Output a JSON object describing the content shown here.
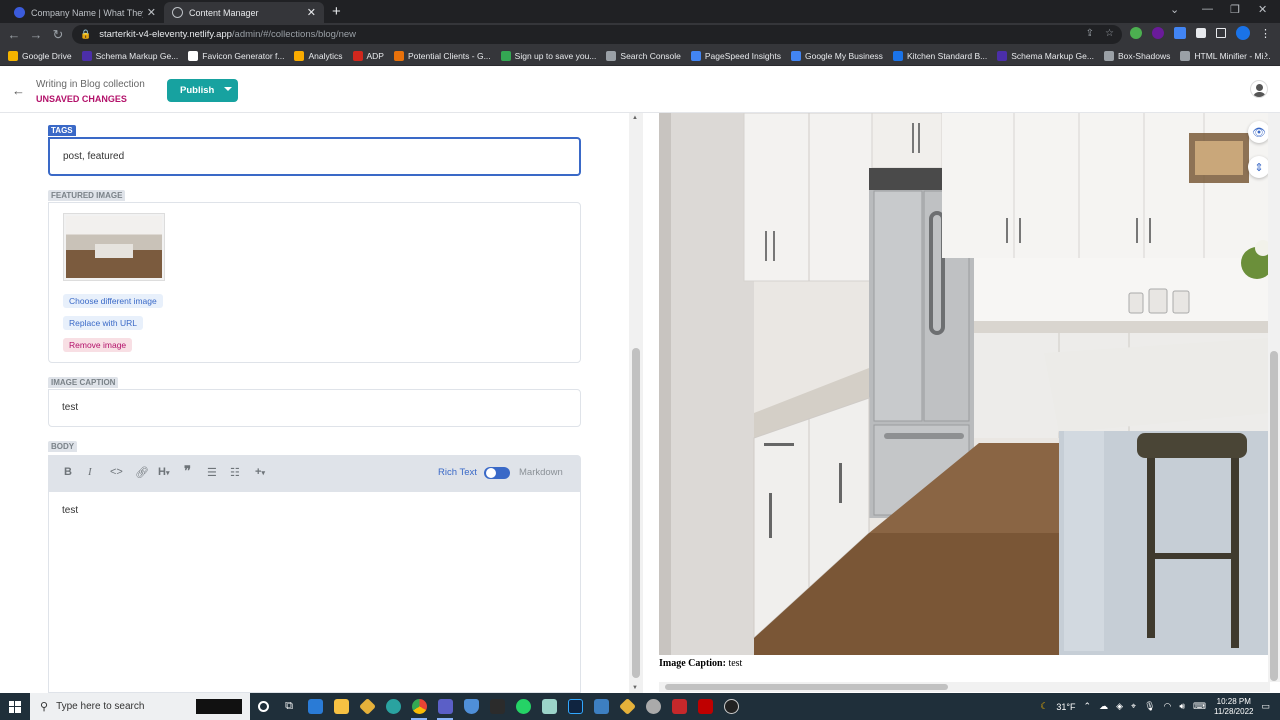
{
  "browser": {
    "tabs": [
      {
        "title": "Company Name | What They Do",
        "icon": "company-favicon",
        "active": false
      },
      {
        "title": "Content Manager",
        "icon": "netlify-cms-favicon",
        "active": true
      }
    ],
    "url_host": "starterkit-v4-eleventy.netlify.app",
    "url_path": "/admin/#/collections/blog/new",
    "bookmarks": [
      {
        "label": "Google Drive",
        "color": "#f4b400"
      },
      {
        "label": "Schema Markup Ge...",
        "color": "#4b2ea8"
      },
      {
        "label": "Favicon Generator f...",
        "color": "#ffffff"
      },
      {
        "label": "Analytics",
        "color": "#f9ab00"
      },
      {
        "label": "ADP",
        "color": "#d0271d"
      },
      {
        "label": "Potential Clients - G...",
        "color": "#e8710a"
      },
      {
        "label": "Sign up to save you...",
        "color": "#34a853"
      },
      {
        "label": "Search Console",
        "color": "#9aa0a6"
      },
      {
        "label": "PageSpeed Insights",
        "color": "#4285f4"
      },
      {
        "label": "Google My Business",
        "color": "#4285f4"
      },
      {
        "label": "Kitchen Standard B...",
        "color": "#1a73e8"
      },
      {
        "label": "Schema Markup Ge...",
        "color": "#4b2ea8"
      },
      {
        "label": "Box-Shadows",
        "color": "#9aa0a6"
      },
      {
        "label": "HTML Minifier - Mi...",
        "color": "#9aa0a6"
      }
    ]
  },
  "header": {
    "status_line": "Writing in Blog collection",
    "unsaved": "UNSAVED CHANGES",
    "publish_label": "Publish"
  },
  "fields": {
    "tags": {
      "label": "TAGS",
      "value": "post, featured"
    },
    "featured_image": {
      "label": "FEATURED IMAGE",
      "choose": "Choose different image",
      "replace": "Replace with URL",
      "remove": "Remove image"
    },
    "image_caption": {
      "label": "IMAGE CAPTION",
      "value": "test"
    },
    "body": {
      "label": "BODY",
      "value": "test",
      "rich_text": "Rich Text",
      "markdown": "Markdown"
    }
  },
  "preview": {
    "caption_label": "Image Caption:",
    "caption_value": "test"
  },
  "taskbar": {
    "search_placeholder": "Type here to search",
    "temperature": "31°F",
    "time": "10:28 PM",
    "date": "11/28/2022"
  },
  "colors": {
    "accent": "#3a69c7",
    "publish": "#17a2a0",
    "unsaved": "#b3116a"
  }
}
